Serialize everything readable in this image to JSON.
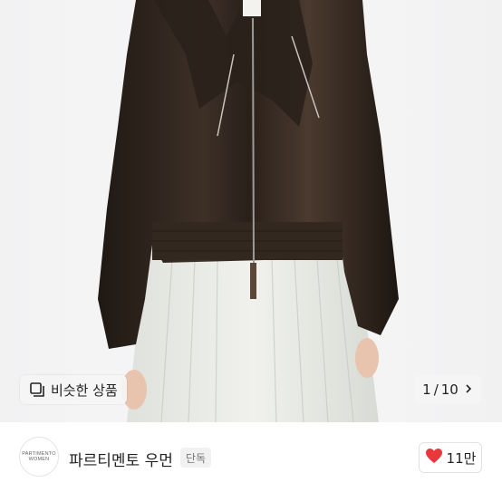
{
  "gallery": {
    "similar_label": "비슷한 상품",
    "page_current": "1",
    "page_total": "10",
    "page_separator": "/"
  },
  "shop": {
    "logo_line1": "PARTIMENTO",
    "logo_line2": "WOMEN",
    "name": "파르티멘토 우먼",
    "badge": "단독"
  },
  "like": {
    "count": "11만"
  },
  "colors": {
    "jacket": "#2e241d",
    "skirt": "#e7e9e4",
    "heart": "#e8383d"
  }
}
